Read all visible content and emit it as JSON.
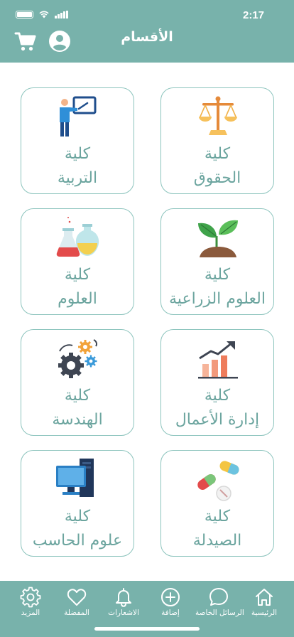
{
  "status_bar": {
    "time": "2:17"
  },
  "header": {
    "title": "الأقسام",
    "icons": [
      "cart-icon",
      "user-icon"
    ]
  },
  "departments": [
    {
      "line1": "كلية",
      "line2": "التربية",
      "icon": "teacher-board-icon"
    },
    {
      "line1": "كلية",
      "line2": "الحقوق",
      "icon": "scales-icon"
    },
    {
      "line1": "كلية",
      "line2": "العلوم",
      "icon": "flasks-icon"
    },
    {
      "line1": "كلية",
      "line2": "العلوم الزراعية",
      "icon": "plant-icon"
    },
    {
      "line1": "كلية",
      "line2": "الهندسة",
      "icon": "gears-icon"
    },
    {
      "line1": "كلية",
      "line2": "إدارة الأعمال",
      "icon": "growth-chart-icon"
    },
    {
      "line1": "كلية",
      "line2": "علوم الحاسب",
      "icon": "computer-icon"
    },
    {
      "line1": "كلية",
      "line2": "الصيدلة",
      "icon": "pills-icon"
    }
  ],
  "bottom_nav": {
    "home": "الرئيسية",
    "messages": "الرسائل الخاصة",
    "add": "إضافة",
    "notifications": "الاشعارات",
    "favorites": "المفضلة",
    "more": "المزيد"
  },
  "colors": {
    "primary": "#78b2ab",
    "card_border": "#8cc4bd",
    "label_text": "#6ca59f"
  }
}
